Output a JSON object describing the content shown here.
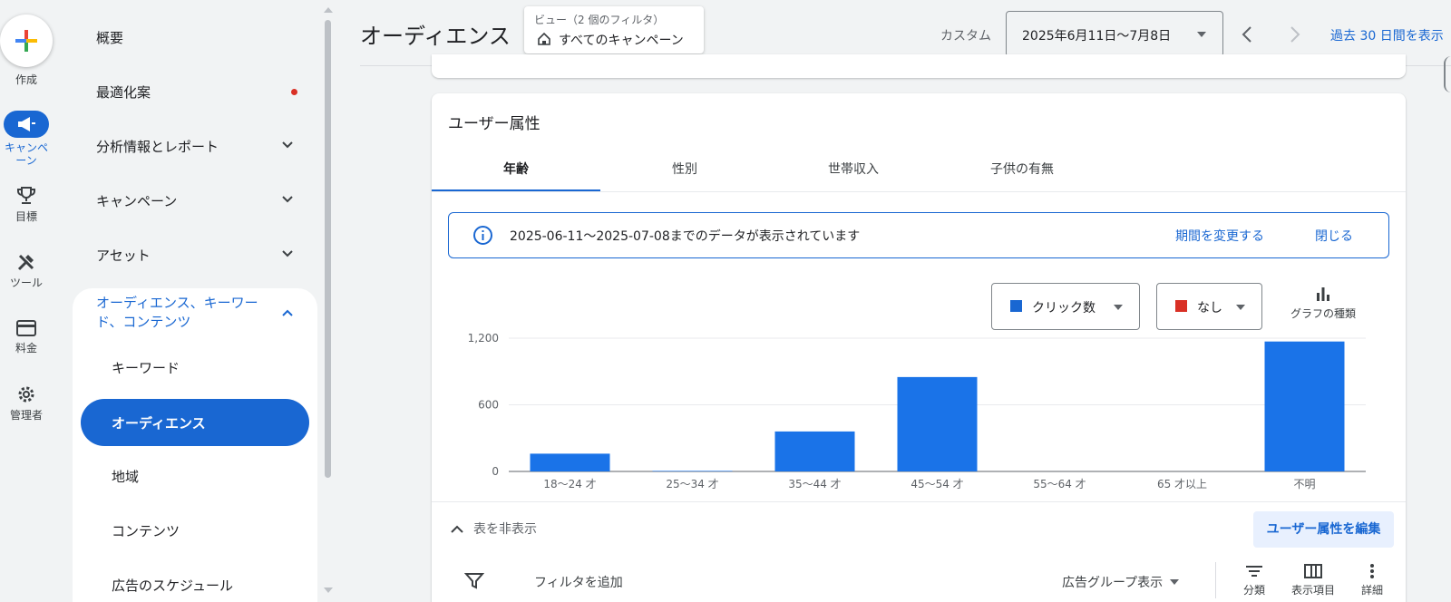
{
  "rail": {
    "create": "作成",
    "campaigns": "キャンペーン",
    "goals": "目標",
    "tools": "ツール",
    "billing": "料金",
    "admin": "管理者"
  },
  "sidebar": {
    "overview": "概要",
    "recommendations": "最適化案",
    "insights_reports": "分析情報とレポート",
    "campaigns": "キャンペーン",
    "assets": "アセット",
    "group_line1": "オーディエンス、キーワー",
    "group_line2": "ド、コンテンツ",
    "items": [
      "キーワード",
      "オーディエンス",
      "地域",
      "コンテンツ",
      "広告のスケジュール"
    ]
  },
  "header": {
    "title": "オーディエンス",
    "view_label": "ビュー（2 個のフィルタ）",
    "view_value": "すべてのキャンペーン",
    "custom_label": "カスタム",
    "date_range": "2025年6月11日〜7月8日",
    "compare_link": "過去 30 日間を表示"
  },
  "card": {
    "title": "ユーザー属性",
    "tabs": [
      "年齢",
      "性別",
      "世帯収入",
      "子供の有無"
    ],
    "info_text": "2025-06-11〜2025-07-08までのデータが表示されています",
    "change_period": "期間を変更する",
    "close": "閉じる",
    "metric1": "クリック数",
    "metric2": "なし",
    "chart_type": "グラフの種類",
    "hide_table": "表を非表示",
    "edit_demographics": "ユーザー属性を編集",
    "add_filter": "フィルタを追加",
    "ad_group_view": "広告グループ表示",
    "segment": "分類",
    "columns": "表示項目",
    "details": "詳細"
  },
  "colors": {
    "accent": "#1967d2",
    "bar": "#1a73e8",
    "metric2": "#d93025"
  },
  "chart_data": {
    "type": "bar",
    "categories": [
      "18〜24 才",
      "25〜34 才",
      "35〜44 才",
      "45〜54 才",
      "55〜64 才",
      "65 才以上",
      "不明"
    ],
    "series": [
      {
        "name": "クリック数",
        "values": [
          160,
          5,
          360,
          850,
          0,
          0,
          1170
        ]
      }
    ],
    "yticks": [
      "0",
      "600",
      "1,200"
    ],
    "ylim": [
      0,
      1200
    ],
    "grid": true
  }
}
